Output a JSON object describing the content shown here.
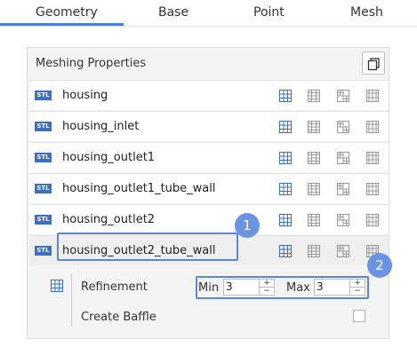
{
  "tabs": [
    {
      "label": "Geometry",
      "active": true
    },
    {
      "label": "Base",
      "active": false
    },
    {
      "label": "Point",
      "active": false
    },
    {
      "label": "Mesh",
      "active": false
    }
  ],
  "panel": {
    "title": "Meshing Properties",
    "copy_icon": "copy-icon"
  },
  "stl_tag": "STL",
  "rows": [
    {
      "name": "housing"
    },
    {
      "name": "housing_inlet"
    },
    {
      "name": "housing_outlet1"
    },
    {
      "name": "housing_outlet1_tube_wall"
    },
    {
      "name": "housing_outlet2"
    },
    {
      "name": "housing_outlet2_tube_wall",
      "selected": true
    }
  ],
  "row_icons": [
    "surface-mesh-icon",
    "volume-mesh-icon",
    "refined-mesh-icon",
    "layer-mesh-icon"
  ],
  "badges": [
    "1",
    "2"
  ],
  "refinement": {
    "label": "Refinement",
    "min_label": "Min",
    "min_value": "3",
    "max_label": "Max",
    "max_value": "3",
    "spin_up": "+",
    "spin_down": "−"
  },
  "baffle": {
    "label": "Create Baffle",
    "checked": false
  },
  "colors": {
    "accent": "#4a7fd4",
    "badge": "#6b93e3",
    "icon_active": "#3b6fc4",
    "icon_inactive": "#9a9a9a"
  }
}
